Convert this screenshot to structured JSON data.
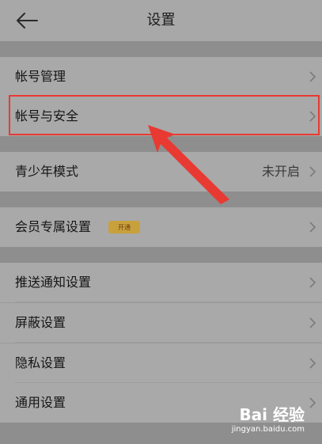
{
  "header": {
    "title": "设置",
    "back_icon": "back-arrow-icon"
  },
  "rows": [
    {
      "label": "帐号管理"
    },
    {
      "label": "帐号与安全"
    },
    {
      "label": "青少年模式",
      "value": "未开启"
    },
    {
      "label": "会员专属设置",
      "badge": "开通"
    },
    {
      "label": "推送通知设置"
    },
    {
      "label": "屏蔽设置"
    },
    {
      "label": "隐私设置"
    },
    {
      "label": "通用设置"
    }
  ],
  "annotation": {
    "highlight_color": "#e83a32"
  },
  "watermark": {
    "logo": "Bai 经验",
    "url": "jingyan.baidu.com"
  }
}
